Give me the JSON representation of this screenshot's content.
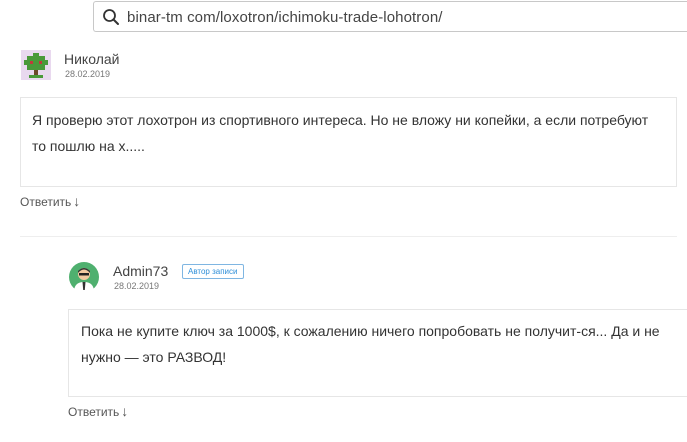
{
  "address_bar": {
    "url": "binar-tm com/loxotron/ichimoku-trade-lohotron/",
    "icon": "search-icon"
  },
  "comments": [
    {
      "author": "Николай",
      "date": "28.02.2019",
      "text": "Я проверю этот лохотрон из спортивного интереса. Но не вложу ни копейки, а если потребуют то пошлю на х.....",
      "reply_label": "Ответить",
      "reply_arrow": "↓",
      "avatar_icon": "green-identicon-avatar"
    },
    {
      "author": "Admin73",
      "badge": "Автор записи",
      "date": "28.02.2019",
      "text": "Пока не купите ключ за 1000$, к сожалению ничего попробовать не получит-ся... Да и не нужно — это РАЗВОД!",
      "reply_label": "Ответить",
      "reply_arrow": "↓",
      "avatar_icon": "admin-avatar"
    }
  ],
  "colors": {
    "badge": "#2f8fd8",
    "border": "#e6e6e6"
  }
}
